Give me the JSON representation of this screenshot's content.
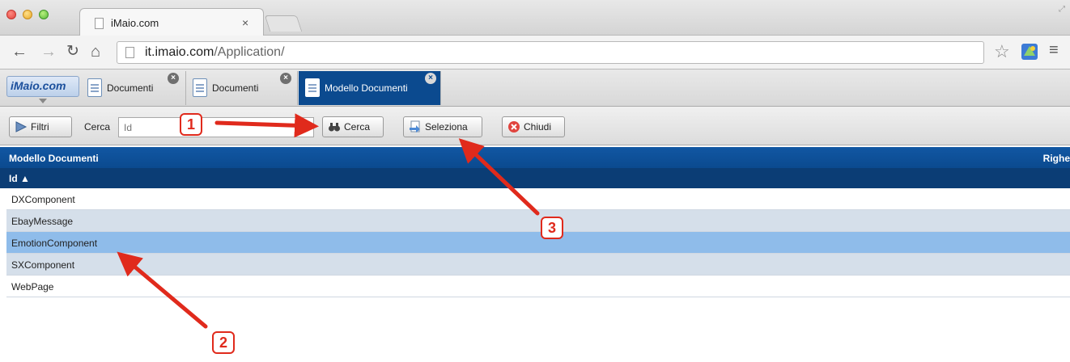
{
  "browser": {
    "tab_title": "iMaio.com",
    "tab_close": "×",
    "url_host": "it.imaio.com",
    "url_path": "/Application/"
  },
  "app": {
    "brand": "iMaio.com",
    "tabs": [
      {
        "label": "Documenti",
        "close": "×"
      },
      {
        "label": "Documenti",
        "close": "×"
      },
      {
        "label": "Modello Documenti",
        "close": "×"
      }
    ]
  },
  "filterbar": {
    "filtri_label": "Filtri",
    "cerca_label": "Cerca",
    "search_placeholder": "Id",
    "cerca_button": "Cerca",
    "seleziona_button": "Seleziona",
    "chiudi_button": "Chiudi"
  },
  "grid": {
    "title": "Modello Documenti",
    "right_label": "Righe",
    "column_header": "Id ▲",
    "rows": [
      "DXComponent",
      "EbayMessage",
      "EmotionComponent",
      "SXComponent",
      "WebPage"
    ],
    "selected_row": "EmotionComponent"
  },
  "annotations": {
    "badge_1": "1",
    "badge_2": "2",
    "badge_3": "3",
    "color": "#e02a1c"
  },
  "colors": {
    "header_blue": "#0b4a8f",
    "selected_row": "#8fbcea",
    "alt_row": "#d5dfea"
  }
}
